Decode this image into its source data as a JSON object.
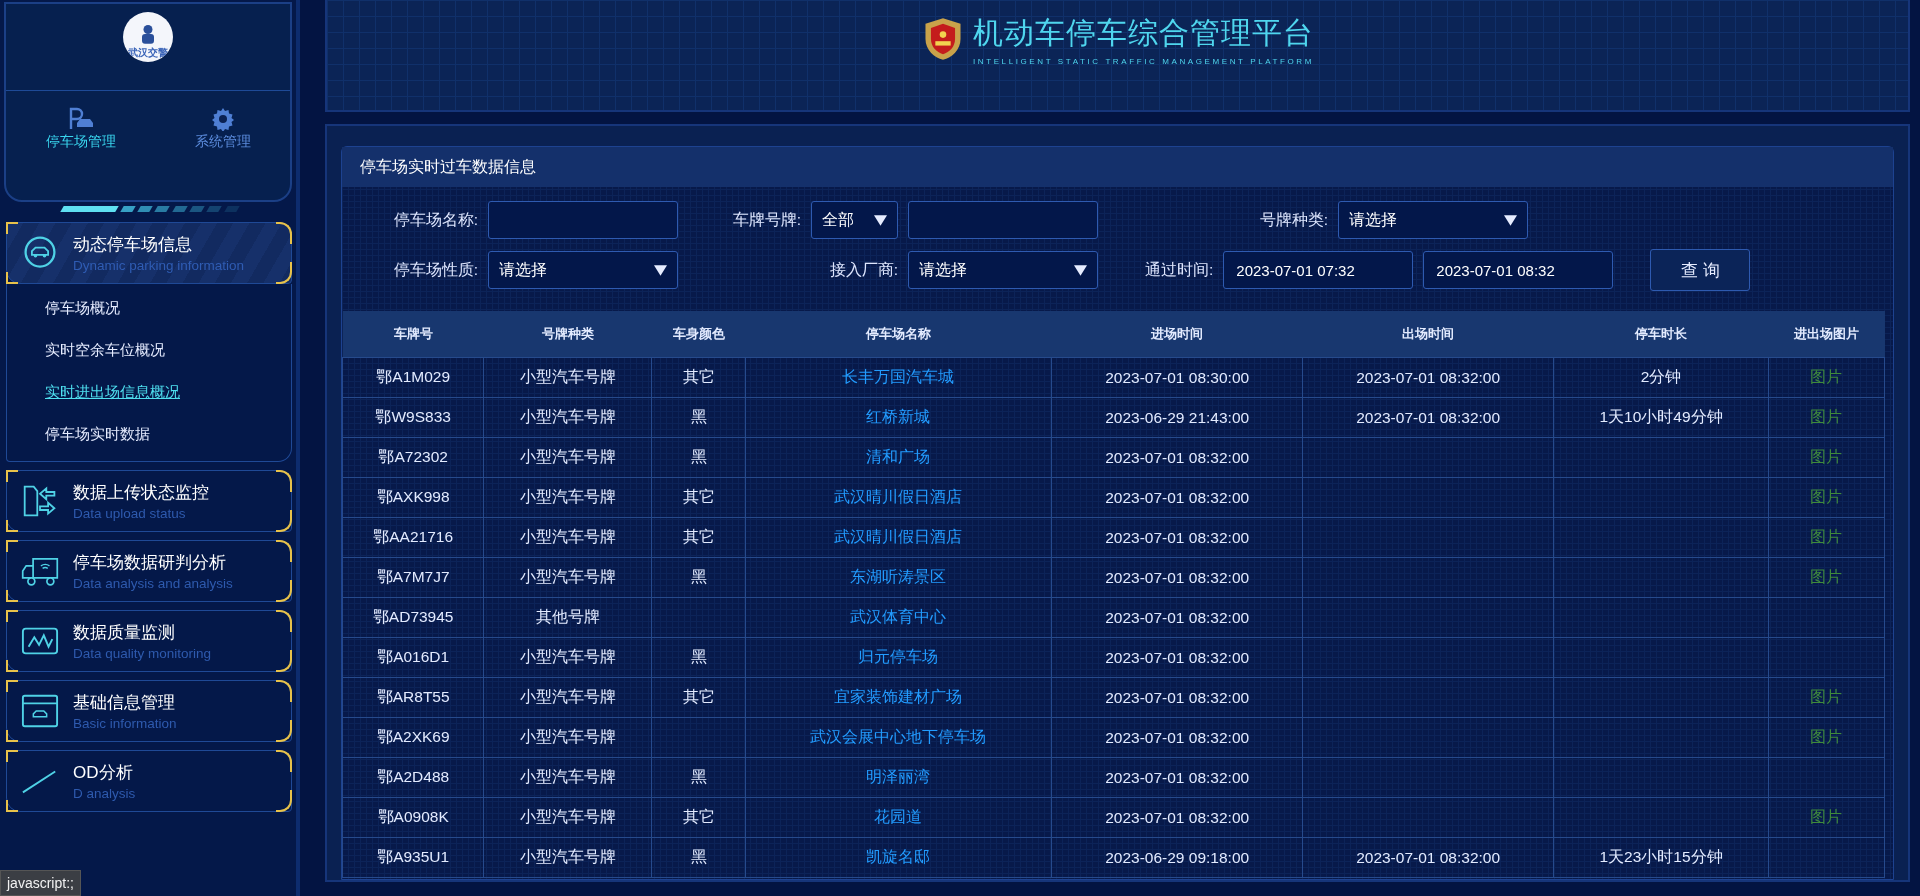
{
  "sidebar": {
    "logo_text": "武汉交警",
    "tabs": [
      {
        "label": "停车场管理",
        "selected": true
      },
      {
        "label": "系统管理",
        "selected": false
      }
    ],
    "groups": [
      {
        "title": "动态停车场信息",
        "subtitle": "Dynamic parking information",
        "expanded": true,
        "children": [
          {
            "label": "停车场概况",
            "selected": false
          },
          {
            "label": "实时空余车位概况",
            "selected": false
          },
          {
            "label": "实时进出场信息概况",
            "selected": true
          },
          {
            "label": "停车场实时数据",
            "selected": false
          }
        ]
      },
      {
        "title": "数据上传状态监控",
        "subtitle": "Data upload status",
        "expanded": false
      },
      {
        "title": "停车场数据研判分析",
        "subtitle": "Data analysis and analysis",
        "expanded": false
      },
      {
        "title": "数据质量监测",
        "subtitle": "Data quality monitoring",
        "expanded": false
      },
      {
        "title": "基础信息管理",
        "subtitle": "Basic information",
        "expanded": false
      },
      {
        "title": "OD分析",
        "subtitle": "D analysis",
        "expanded": false
      }
    ]
  },
  "header": {
    "title": "机动车停车综合管理平台",
    "subtitle": "INTELLIGENT STATIC TRAFFIC MANAGEMENT PLATFORM"
  },
  "panel": {
    "title": "停车场实时过车数据信息",
    "filters": [
      {
        "label": "停车场名称:",
        "kind": "input"
      },
      {
        "label": "车牌号牌:",
        "kind": "select-input",
        "value": "全部"
      },
      {
        "label": "号牌种类:",
        "kind": "select",
        "value": "请选择"
      },
      {
        "label": "停车场性质:",
        "kind": "select",
        "value": "请选择"
      },
      {
        "label": "接入厂商:",
        "kind": "select",
        "value": "请选择"
      },
      {
        "label": "通过时间:",
        "kind": "range",
        "from": "2023-07-01 07:32",
        "to": "2023-07-01 08:32"
      }
    ],
    "search_button": "查 询",
    "table": {
      "columns": [
        "车牌号",
        "号牌种类",
        "车身颜色",
        "停车场名称",
        "进场时间",
        "出场时间",
        "停车时长",
        "进出场图片"
      ],
      "rows": [
        {
          "plate": "鄂A1M029",
          "plate_type": "小型汽车号牌",
          "body_color": "其它",
          "lot": "长丰万国汽车城",
          "entry": "2023-07-01 08:30:00",
          "exit": "2023-07-01 08:32:00",
          "duration": "2分钟",
          "photo": "图片"
        },
        {
          "plate": "鄂W9S833",
          "plate_type": "小型汽车号牌",
          "body_color": "黑",
          "lot": "红桥新城",
          "entry": "2023-06-29 21:43:00",
          "exit": "2023-07-01 08:32:00",
          "duration": "1天10小时49分钟",
          "photo": "图片"
        },
        {
          "plate": "鄂A72302",
          "plate_type": "小型汽车号牌",
          "body_color": "黑",
          "lot": "清和广场",
          "entry": "2023-07-01 08:32:00",
          "photo": "图片"
        },
        {
          "plate": "鄂AXK998",
          "plate_type": "小型汽车号牌",
          "body_color": "其它",
          "lot": "武汉晴川假日酒店",
          "entry": "2023-07-01 08:32:00",
          "photo": "图片"
        },
        {
          "plate": "鄂AA21716",
          "plate_type": "小型汽车号牌",
          "body_color": "其它",
          "lot": "武汉晴川假日酒店",
          "entry": "2023-07-01 08:32:00",
          "photo": "图片"
        },
        {
          "plate": "鄂A7M7J7",
          "plate_type": "小型汽车号牌",
          "body_color": "黑",
          "lot": "东湖听涛景区",
          "entry": "2023-07-01 08:32:00",
          "photo": "图片"
        },
        {
          "plate": "鄂AD73945",
          "plate_type": "其他号牌",
          "lot": "武汉体育中心",
          "entry": "2023-07-01 08:32:00"
        },
        {
          "plate": "鄂A016D1",
          "plate_type": "小型汽车号牌",
          "body_color": "黑",
          "lot": "归元停车场",
          "entry": "2023-07-01 08:32:00"
        },
        {
          "plate": "鄂AR8T55",
          "plate_type": "小型汽车号牌",
          "body_color": "其它",
          "lot": "宜家装饰建材广场",
          "entry": "2023-07-01 08:32:00",
          "photo": "图片"
        },
        {
          "plate": "鄂A2XK69",
          "plate_type": "小型汽车号牌",
          "lot": "武汉会展中心地下停车场",
          "entry": "2023-07-01 08:32:00",
          "photo": "图片"
        },
        {
          "plate": "鄂A2D488",
          "plate_type": "小型汽车号牌",
          "body_color": "黑",
          "lot": "明泽丽湾",
          "entry": "2023-07-01 08:32:00"
        },
        {
          "plate": "鄂A0908K",
          "plate_type": "小型汽车号牌",
          "body_color": "其它",
          "lot": "花园道",
          "entry": "2023-07-01 08:32:00",
          "photo": "图片"
        },
        {
          "plate": "鄂A935U1",
          "plate_type": "小型汽车号牌",
          "body_color": "黑",
          "lot": "凯旋名邸",
          "entry": "2023-06-29 09:18:00",
          "exit": "2023-07-01 08:32:00",
          "duration": "1天23小时15分钟"
        }
      ]
    }
  },
  "status_bar": {
    "text": "javascript:;"
  }
}
